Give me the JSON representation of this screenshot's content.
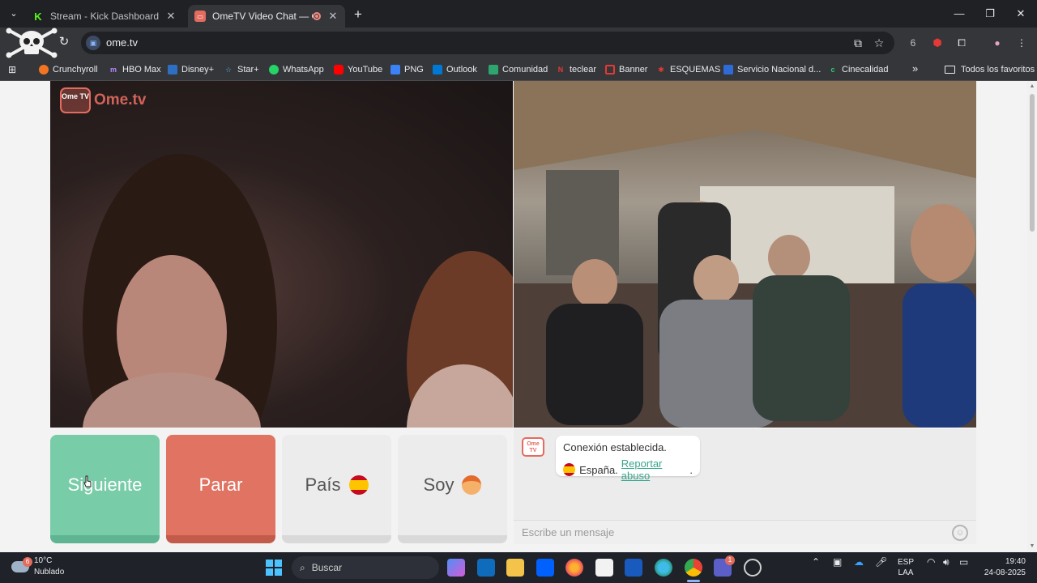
{
  "browser": {
    "tabs": [
      {
        "title": "Stream - Kick Dashboard",
        "active": false
      },
      {
        "title": "OmeTV Video Chat — Ome",
        "active": true
      }
    ],
    "url": "ome.tv",
    "extension_badge": "6",
    "bookmarks": [
      {
        "label": "Crunchyroll",
        "color": "#f47521"
      },
      {
        "label": "HBO Max",
        "color": "#8a3ffc"
      },
      {
        "label": "Disney+",
        "color": "#2d6fc2"
      },
      {
        "label": "Star+",
        "color": "#5ab4e6"
      },
      {
        "label": "WhatsApp",
        "color": "#25d366"
      },
      {
        "label": "YouTube",
        "color": "#ff0000"
      },
      {
        "label": "PNG",
        "color": "#3b82f6"
      },
      {
        "label": "Outlook",
        "color": "#0078d4"
      },
      {
        "label": "Comunidad",
        "color": "#2ea56f"
      },
      {
        "label": "teclear",
        "color": "#e53935"
      },
      {
        "label": "Banner",
        "color": "#e53935"
      },
      {
        "label": "ESQUEMAS",
        "color": "#e53935"
      },
      {
        "label": "Servicio Nacional d...",
        "color": "#2f6bd6"
      },
      {
        "label": "Cinecalidad",
        "color": "#2ecc71"
      }
    ],
    "all_bookmarks": "Todos los favoritos"
  },
  "app": {
    "logo_text": "Ome.tv",
    "logo_badge": "Ome TV",
    "buttons": {
      "next": "Siguiente",
      "stop": "Parar",
      "country": "País",
      "gender": "Soy"
    },
    "chat": {
      "status": "Conexión establecida.",
      "country": "España.",
      "report": "Reportar abuso",
      "report_suffix": ".",
      "placeholder": "Escribe un mensaje"
    }
  },
  "taskbar": {
    "weather_temp": "10°C",
    "weather_desc": "Nublado",
    "weather_badge": "6",
    "search": "Buscar",
    "lang1": "ESP",
    "lang2": "LAA",
    "time": "19:40",
    "date": "24-08-2025",
    "teams_badge": "1"
  }
}
